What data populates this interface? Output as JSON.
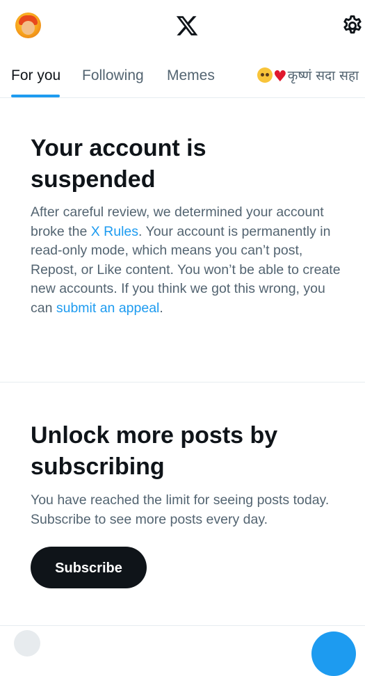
{
  "header": {
    "avatar_icon": "profile-avatar",
    "logo_icon": "x-logo-icon",
    "settings_icon": "gear-icon"
  },
  "tabs": [
    {
      "label": "For you",
      "active": true
    },
    {
      "label": "Following",
      "active": false
    },
    {
      "label": "Memes",
      "active": false
    },
    {
      "label": "कृष्णं सदा सहा",
      "active": false,
      "prefix_icons": [
        "pleading-face-emoji",
        "red-heart-emoji"
      ]
    }
  ],
  "suspended": {
    "title": "Your account is suspended",
    "text_1": "After careful review, we determined your account broke the ",
    "rules_link": "X Rules",
    "text_2": ". Your account is permanently in read-only mode, which means you can’t post, Repost, or Like content. You won’t be able to create new accounts. If you think we got this wrong, you can ",
    "appeal_link": "submit an appeal",
    "text_3": "."
  },
  "subscribe": {
    "title": "Unlock more posts by subscribing",
    "text": "You have reached the limit for seeing posts today. Subscribe to see more posts every day.",
    "button_label": "Subscribe"
  },
  "colors": {
    "accent": "#1d9bf0",
    "text_primary": "#0f1419",
    "text_secondary": "#536471",
    "divider": "#e6ecf0"
  }
}
